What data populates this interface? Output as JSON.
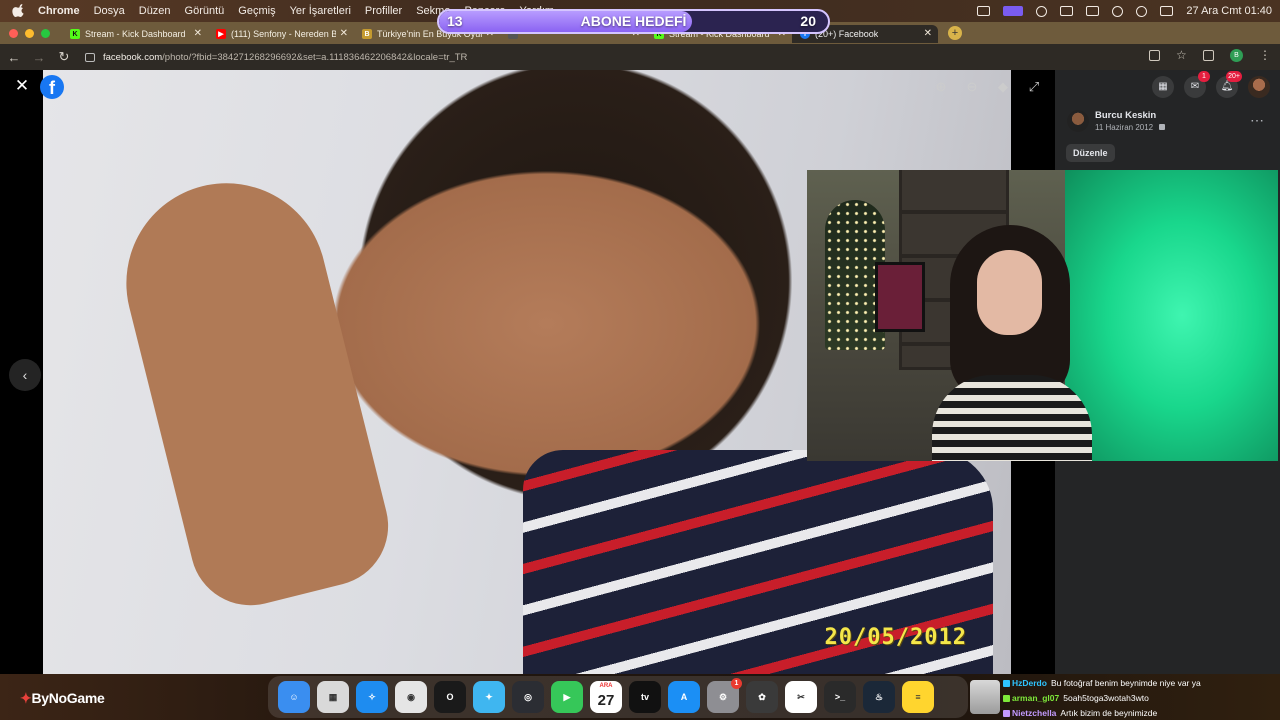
{
  "menubar": {
    "app": "Chrome",
    "items": [
      "Dosya",
      "Düzen",
      "Görüntü",
      "Geçmiş",
      "Yer İşaretleri",
      "Profiller",
      "Sekme",
      "Pencere",
      "Yardım"
    ],
    "clock": "27 Ara Cmt  01:40"
  },
  "goal": {
    "title": "ABONE HEDEFİ",
    "current": "13",
    "target": "20",
    "progress_fraction": 0.65,
    "colors": {
      "fill": "#9a78f5",
      "track": "#2b2350"
    }
  },
  "tabs": [
    {
      "title": "Stream - Kick Dashboard",
      "icon": "kick-icon",
      "color": "#53fc18",
      "letter": "K"
    },
    {
      "title": "(111) Senfony - Nereden Bilece",
      "icon": "youtube-icon",
      "color": "#ff0000",
      "letter": "▶"
    },
    {
      "title": "Türkiye'nin En Büyük Oyun",
      "icon": "bynogame-icon",
      "color": "#c49a2f",
      "letter": "B"
    },
    {
      "title": "",
      "icon": "site-icon",
      "color": "#555555",
      "letter": ""
    },
    {
      "title": "Stream - Kick Dashboard",
      "icon": "kick-icon",
      "color": "#53fc18",
      "letter": "K"
    },
    {
      "title": "(20+) Facebook",
      "icon": "facebook-icon",
      "color": "#1877f2",
      "letter": "f"
    }
  ],
  "address": {
    "host": "facebook.com",
    "path": "/photo/?fbid=384271268296692&set=a.111836462206842&locale=tr_TR"
  },
  "photo": {
    "date_stamp": "20/05/2012"
  },
  "profile_badge": "B",
  "right_panel": {
    "messenger_badge": "1",
    "notifications_badge": "20+",
    "author_name": "Burcu Keskin",
    "post_date": "11 Haziran 2012",
    "edit_label": "Düzenle"
  },
  "dock": {
    "calendar_month": "ARA",
    "calendar_day": "27",
    "settings_badge": "1",
    "apps": [
      {
        "name": "finder-icon",
        "color": "#3a8ef0",
        "glyph": "☺"
      },
      {
        "name": "launchpad-icon",
        "color": "#d9d9d9",
        "glyph": "▦"
      },
      {
        "name": "safari-icon",
        "color": "#1e8cf0",
        "glyph": "✧"
      },
      {
        "name": "chrome-icon",
        "color": "#e5e5e5",
        "glyph": "◉"
      },
      {
        "name": "opera-icon",
        "color": "#1a1a1a",
        "glyph": "O"
      },
      {
        "name": "altstore-icon",
        "color": "#3fb6f0",
        "glyph": "✦"
      },
      {
        "name": "obs-icon",
        "color": "#2b2d33",
        "glyph": "◎"
      },
      {
        "name": "facetime-icon",
        "color": "#36c759",
        "glyph": "▶"
      }
    ],
    "apps2": [
      {
        "name": "appletv-icon",
        "color": "#111111",
        "glyph": "tv"
      },
      {
        "name": "appstore-icon",
        "color": "#1b8ff5",
        "glyph": "A"
      },
      {
        "name": "system-settings-icon",
        "color": "#8e8e93",
        "glyph": "⚙"
      },
      {
        "name": "fl-studio-icon",
        "color": "#3a3a3a",
        "glyph": "✿"
      },
      {
        "name": "capcut-icon",
        "color": "#ffffff",
        "glyph": "✂"
      },
      {
        "name": "terminal-icon",
        "color": "#2a2a2a",
        "glyph": ">_"
      },
      {
        "name": "steam-icon",
        "color": "#1b2838",
        "glyph": "♨"
      },
      {
        "name": "notes-icon",
        "color": "#ffd52e",
        "glyph": "≡"
      }
    ]
  },
  "branding": {
    "name": "ByNoGame",
    "prefix": ""
  },
  "chat": [
    {
      "user": "HzDerdo",
      "color": "#2ec4ff",
      "message": "Bu fotoğraf benim beynimde niye var ya"
    },
    {
      "user": "arman_gl07",
      "color": "#7ee83a",
      "message": "5oah5toga3wotah3wto"
    },
    {
      "user": "Nietzchella",
      "color": "#c39bff",
      "message": "Artık bizim de beynimizde"
    }
  ]
}
